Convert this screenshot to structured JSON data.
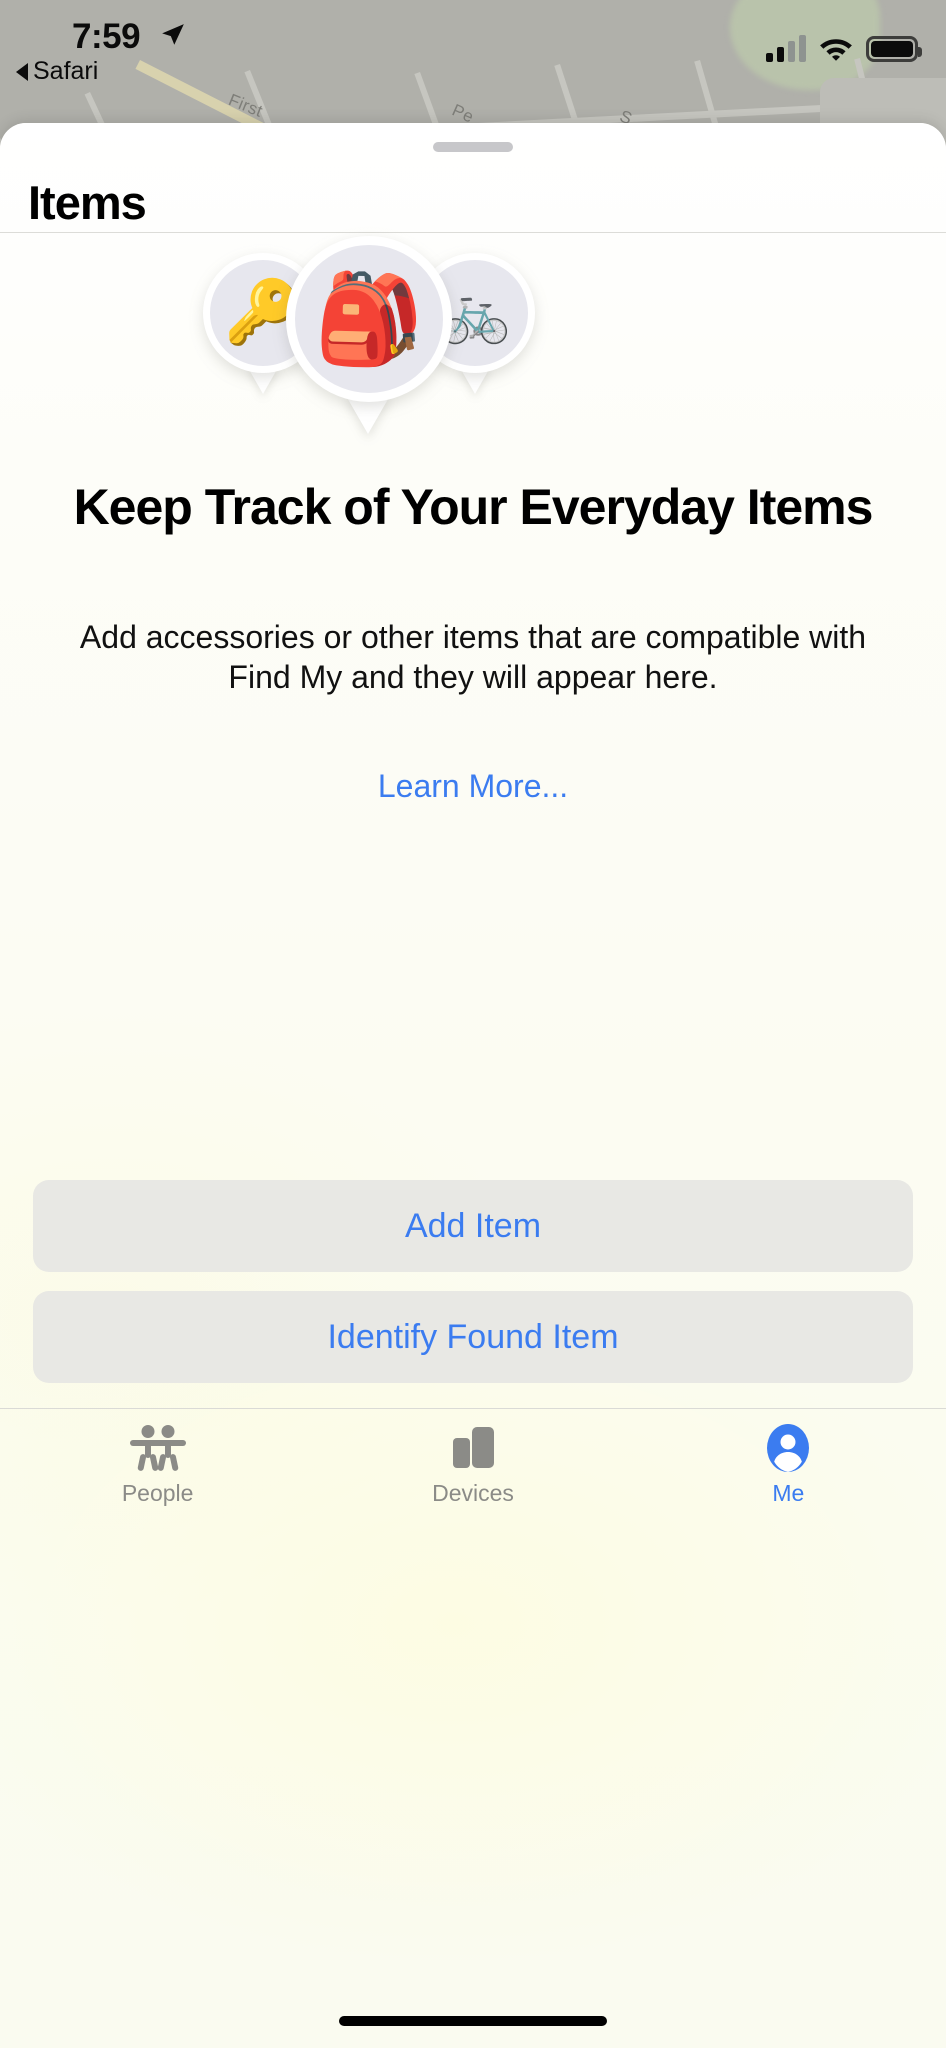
{
  "status_bar": {
    "time": "7:59",
    "back_label": "Safari",
    "location_arrow_icon": "location-arrow-icon",
    "signal_icon": "cellular-signal-icon",
    "signal_bars_filled": 2,
    "signal_bars_total": 4,
    "wifi_icon": "wifi-icon",
    "battery_icon": "battery-full-icon"
  },
  "map": {
    "street_labels": [
      "First",
      "Pe",
      "S"
    ]
  },
  "sheet": {
    "grabber_icon": "sheet-grabber-handle",
    "title": "Items"
  },
  "illustration": {
    "pins": [
      {
        "name": "key-pin",
        "glyph": "🔑",
        "icon": "key-icon"
      },
      {
        "name": "backpack-pin",
        "glyph": "🎒",
        "icon": "backpack-icon"
      },
      {
        "name": "bicycle-pin",
        "glyph": "🚲",
        "icon": "bicycle-icon"
      }
    ]
  },
  "empty_state": {
    "headline": "Keep Track of Your Everyday Items",
    "body": "Add accessories or other items that are compatible with Find My and they will appear here.",
    "learn_more_label": "Learn More..."
  },
  "actions": {
    "add_item_label": "Add Item",
    "identify_found_item_label": "Identify Found Item"
  },
  "tab_bar": {
    "items": [
      {
        "label": "People",
        "icon": "people-icon",
        "active": false
      },
      {
        "label": "Devices",
        "icon": "devices-icon",
        "active": false
      },
      {
        "label": "Me",
        "icon": "me-person-icon",
        "active": true
      }
    ]
  },
  "colors": {
    "accent_blue": "#3b7cf0",
    "tab_inactive": "#8b8b87",
    "button_background": "#e8e8e4",
    "sheet_background": "#fbfbf6",
    "pin_fill": "#e7e7ee"
  }
}
